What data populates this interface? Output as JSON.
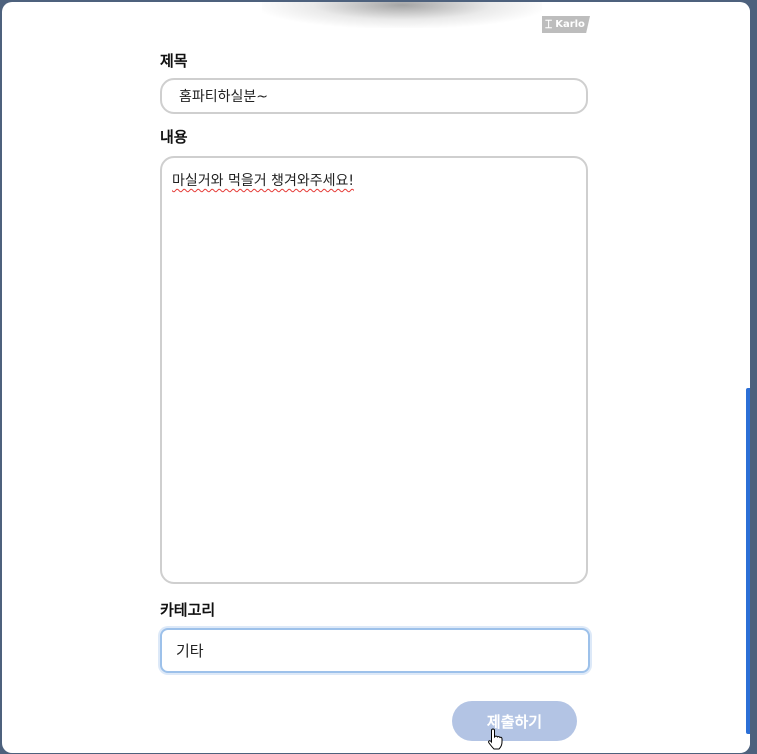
{
  "brand": {
    "name": "Karlo"
  },
  "form": {
    "title_label": "제목",
    "title_value": "홈파티하실분~",
    "content_label": "내용",
    "content_value": "마실거와 먹을거 챙겨와주세요!",
    "category_label": "카테고리",
    "category_value": "기타",
    "submit_label": "제출하기"
  },
  "colors": {
    "accent": "#b3c4e4",
    "scroll_thumb": "#2c6fd6",
    "focus_border": "#9dc1ea",
    "backdrop": "#4a5d78"
  },
  "icons": {
    "cursor": "hand-pointer-icon",
    "brand": "karlo-logo-icon"
  }
}
